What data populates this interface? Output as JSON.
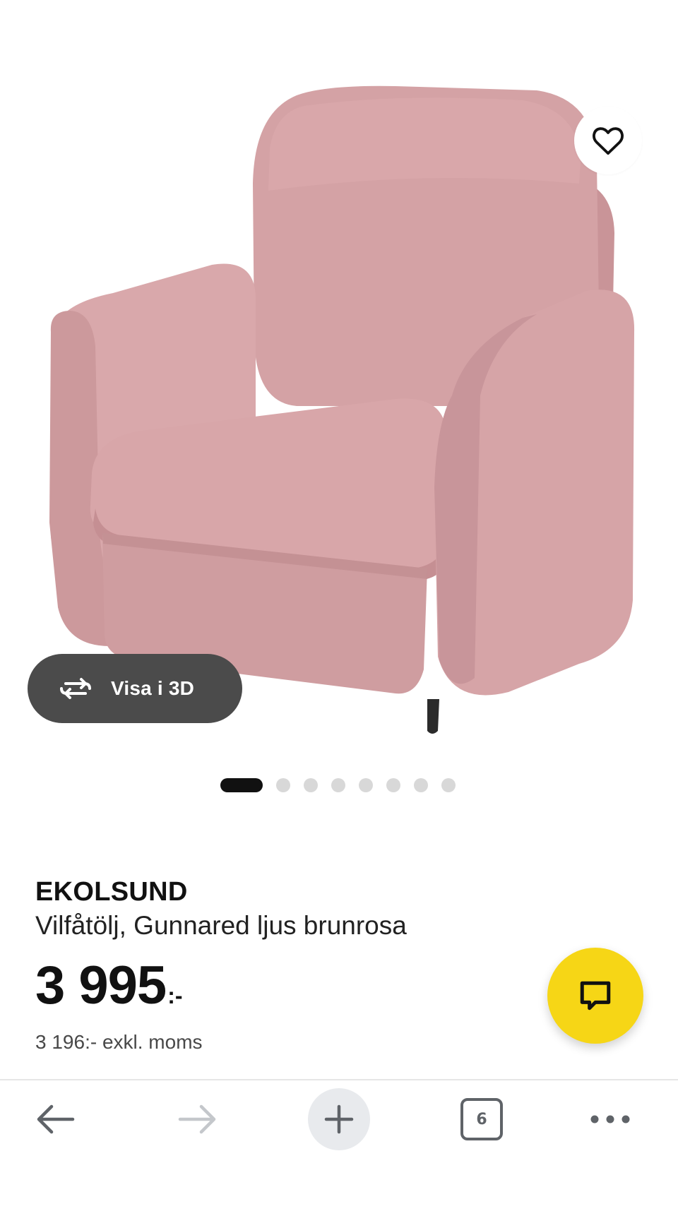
{
  "product": {
    "brand": "EKOLSUND",
    "description": "Vilfåtölj, Gunnared ljus brunrosa",
    "price": "3 995",
    "price_suffix": ":-",
    "price_ex_vat": "3 196:- exkl. moms"
  },
  "image_viewer": {
    "view_3d_label": "Visa i 3D",
    "dot_count": 8,
    "active_dot": 0
  },
  "icons": {
    "favorite": "heart-outline-icon",
    "view_3d": "rotate-arrows-icon",
    "chat": "chat-bubble-icon",
    "back": "arrow-left-icon",
    "forward": "arrow-right-icon",
    "new_tab": "plus-icon",
    "tabs": "tabs-count-icon",
    "menu": "more-horizontal-icon"
  },
  "browser": {
    "tab_count": "6"
  },
  "colors": {
    "chair_fabric": "#d5a3a6",
    "chat_button": "#f6d616",
    "view_3d_button": "#4b4b4b",
    "dot_active": "#111111",
    "dot_inactive": "#d8d8d8"
  }
}
